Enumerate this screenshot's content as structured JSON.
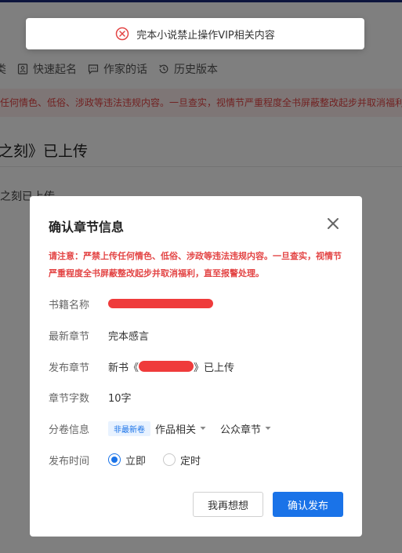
{
  "toast": {
    "icon": "error-circle-icon",
    "message": "完本小说禁止操作VIP相关内容",
    "color": "#e34545"
  },
  "background": {
    "toolbar": [
      {
        "label": "类",
        "icon": "none"
      },
      {
        "label": "快速起名",
        "icon": "id-card-icon"
      },
      {
        "label": "作家的话",
        "icon": "message-icon"
      },
      {
        "label": "历史版本",
        "icon": "history-icon"
      }
    ],
    "warning": "任何情色、低俗、涉政等违法违规内容。一旦查实，视情节严重程度全书屏蔽整改起步并取消福利",
    "title": "之刻》已上传",
    "body": "之刻已上传"
  },
  "modal": {
    "title": "确认章节信息",
    "notice": "请注意：严禁上传任何情色、低俗、涉政等违法违规内容。一旦查实，视情节严重程度全书屏蔽整改起步并取消福利，直至报警处理。",
    "labels": {
      "book_name": "书籍名称",
      "latest_chapter": "最新章节",
      "publish_chapter": "发布章节",
      "word_count": "章节字数",
      "volume_info": "分卷信息",
      "publish_time": "发布时间"
    },
    "values": {
      "latest_chapter": "完本感言",
      "publish_prefix": "新书《",
      "publish_suffix": "》已上传",
      "word_count": "10字",
      "volume_badge": "非最新卷",
      "volume_select": "作品相关",
      "chapter_type_select": "公众章节"
    },
    "publish_options": [
      {
        "label": "立即",
        "selected": true
      },
      {
        "label": "定时",
        "selected": false
      }
    ],
    "cancel_label": "我再想想",
    "confirm_label": "确认发布",
    "accent_color": "#1a73e8",
    "redaction_color": "#ef3b3b"
  }
}
